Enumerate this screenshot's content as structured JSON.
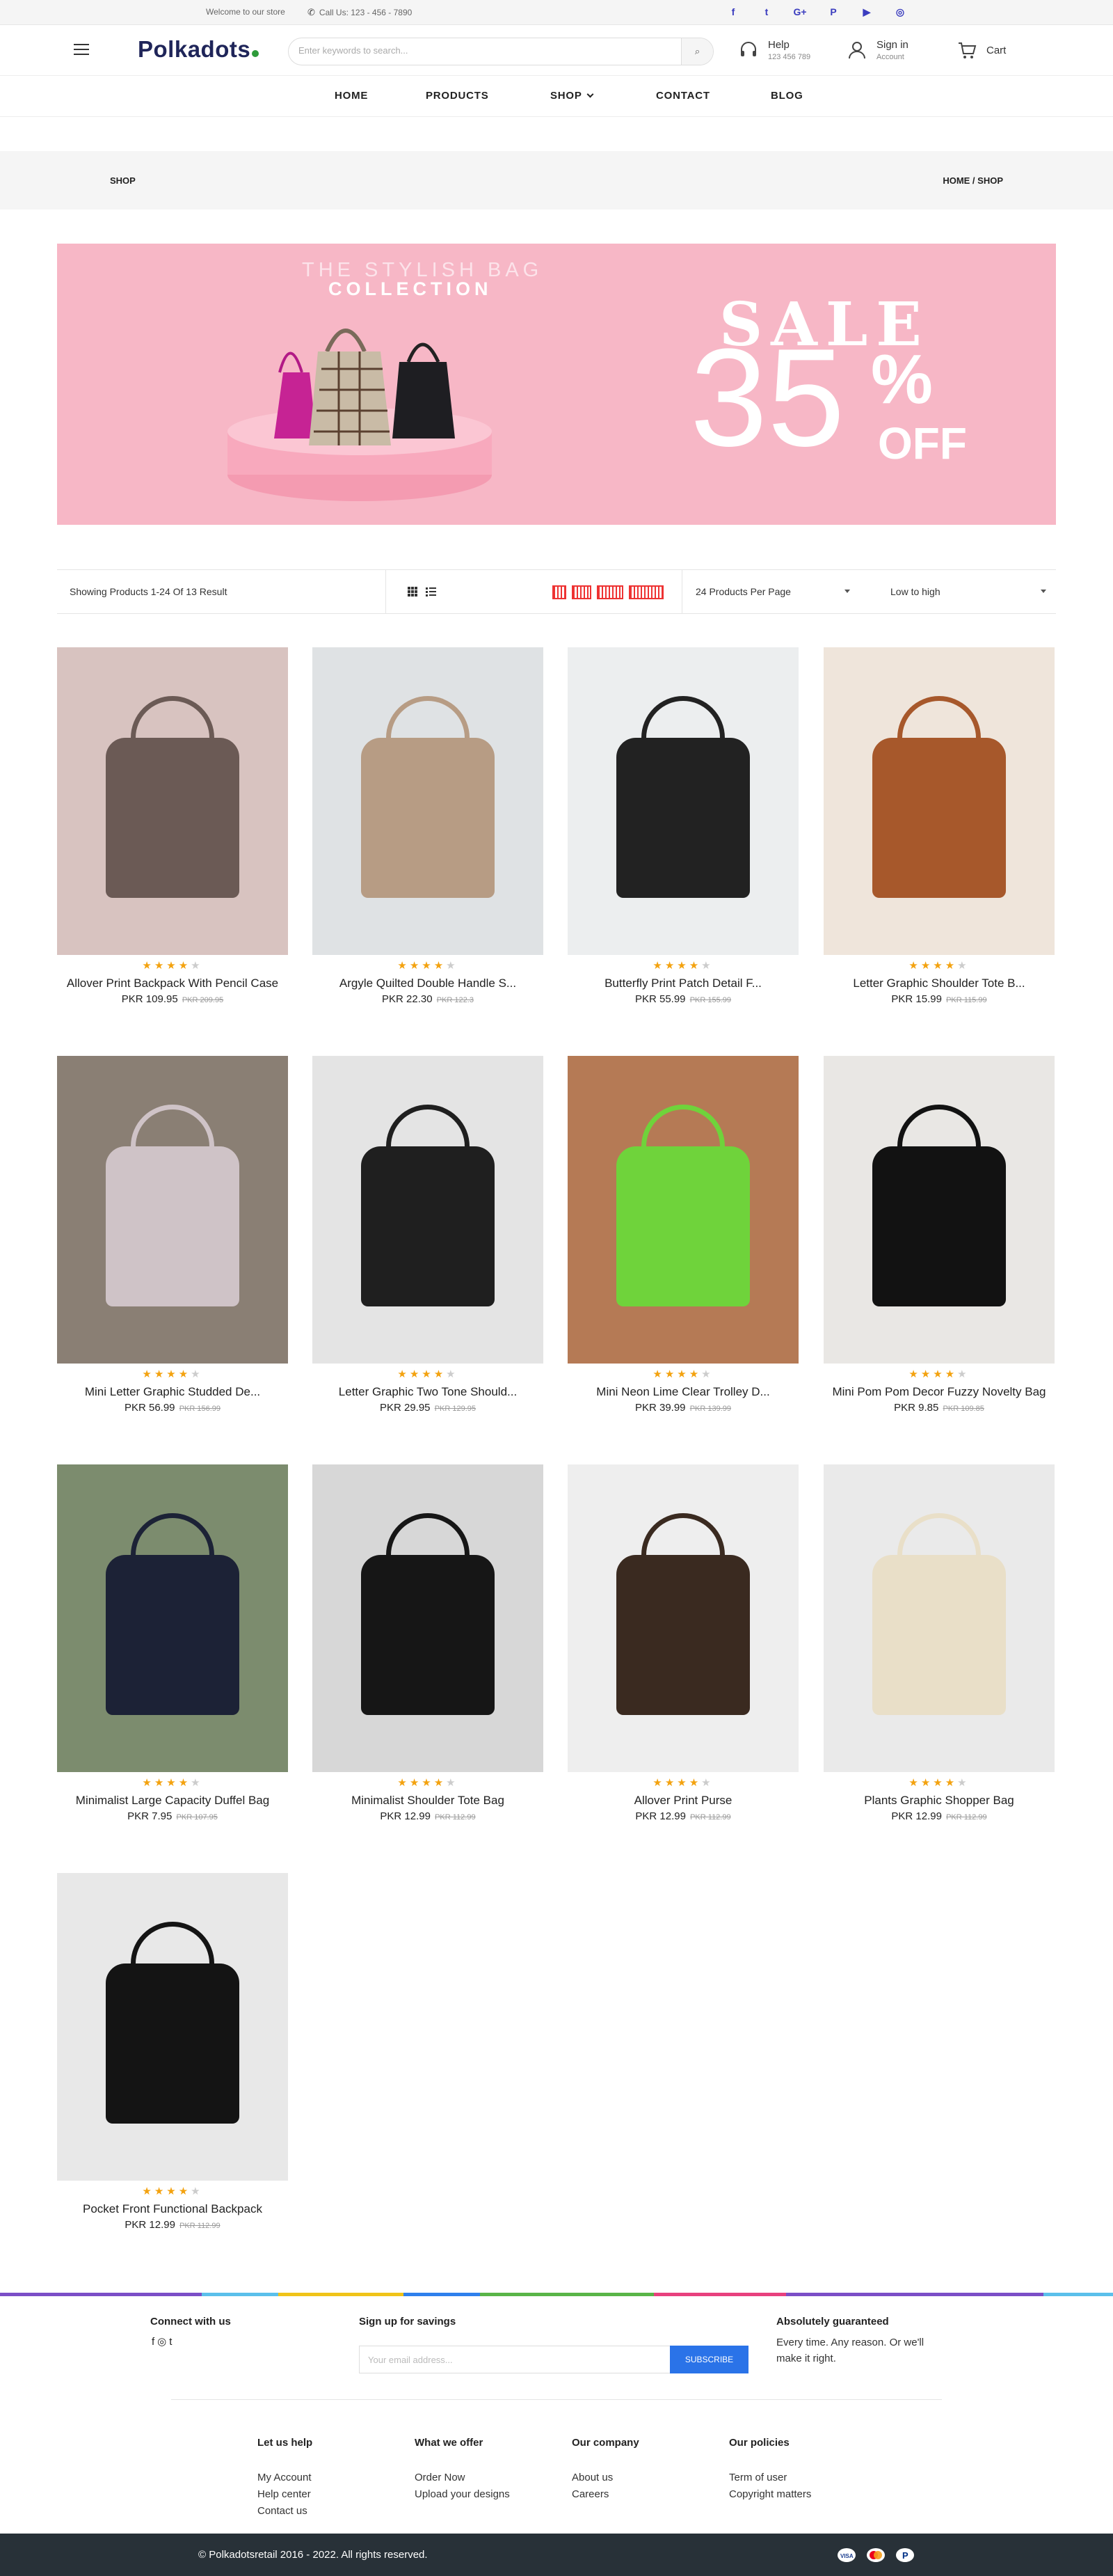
{
  "topbar": {
    "welcome": "Welcome to our store",
    "call": "Call Us: 123 - 456 - 7890",
    "social_icons": [
      "facebook-icon",
      "twitter-icon",
      "google-plus-icon",
      "pinterest-icon",
      "youtube-icon",
      "instagram-icon"
    ],
    "social_glyphs": [
      "f",
      "t",
      "G+",
      "P",
      "▶",
      "◎"
    ]
  },
  "header": {
    "logo": "Polkadots",
    "search_placeholder": "Enter keywords to search...",
    "help_label": "Help",
    "help_phone": "123 456 789",
    "signin_label": "Sign in",
    "signin_sub": "Account",
    "cart_label": "Cart"
  },
  "nav": {
    "items": [
      "HOME",
      "PRODUCTS",
      "SHOP",
      "CONTACT",
      "BLOG"
    ]
  },
  "breadcrumb": {
    "page_title": "SHOP",
    "trail": "HOME / SHOP"
  },
  "banner": {
    "line1": "THE STYLISH BAG",
    "line2": "COLLECTION",
    "sale": "SALE",
    "number": "35",
    "percent": "%",
    "off": "OFF"
  },
  "toolbar": {
    "showing": "Showing Products 1-24 Of 13 Result",
    "per_page": "24 Products Per Page",
    "sort": "Low to high"
  },
  "products": [
    {
      "name": "Allover Print Backpack With Pencil Case",
      "price": "PKR 109.95",
      "old": "PKR 209.95",
      "rating": 4
    },
    {
      "name": "Argyle Quilted Double Handle S...",
      "price": "PKR 22.30",
      "old": "PKR 122.3",
      "rating": 4
    },
    {
      "name": "Butterfly Print Patch Detail F...",
      "price": "PKR 55.99",
      "old": "PKR 155.99",
      "rating": 4
    },
    {
      "name": "Letter Graphic Shoulder Tote B...",
      "price": "PKR 15.99",
      "old": "PKR 115.99",
      "rating": 4
    },
    {
      "name": "Mini Letter Graphic Studded De...",
      "price": "PKR 56.99",
      "old": "PKR 156.99",
      "rating": 4
    },
    {
      "name": "Letter Graphic Two Tone Should...",
      "price": "PKR 29.95",
      "old": "PKR 129.95",
      "rating": 4
    },
    {
      "name": "Mini Neon Lime Clear Trolley D...",
      "price": "PKR 39.99",
      "old": "PKR 139.99",
      "rating": 4
    },
    {
      "name": "Mini Pom Pom Decor Fuzzy Novelty Bag",
      "price": "PKR 9.85",
      "old": "PKR 109.85",
      "rating": 4
    },
    {
      "name": "Minimalist Large Capacity Duffel Bag",
      "price": "PKR 7.95",
      "old": "PKR 107.95",
      "rating": 4
    },
    {
      "name": "Minimalist Shoulder Tote Bag",
      "price": "PKR 12.99",
      "old": "PKR 112.99",
      "rating": 4
    },
    {
      "name": "Allover Print Purse",
      "price": "PKR 12.99",
      "old": "PKR 112.99",
      "rating": 4
    },
    {
      "name": "Plants Graphic Shopper Bag",
      "price": "PKR 12.99",
      "old": "PKR 112.99",
      "rating": 4
    },
    {
      "name": "Pocket Front Functional Backpack",
      "price": "PKR 12.99",
      "old": "PKR 112.99",
      "rating": 4
    }
  ],
  "footer": {
    "connect_title": "Connect with us",
    "social_glyphs": "f◎t",
    "signup_title": "Sign up for savings",
    "email_placeholder": "Your email address...",
    "subscribe": "SUBSCRIBE",
    "guarantee_title": "Absolutely guaranteed",
    "guarantee_text_1": "Every time. Any reason. Or we'll",
    "guarantee_text_2": "make it right.",
    "columns": [
      {
        "title": "Let us help",
        "links": [
          "My Account",
          "Help center",
          "Contact us"
        ]
      },
      {
        "title": "What we offer",
        "links": [
          "Order Now",
          "Upload your designs"
        ]
      },
      {
        "title": "Our company",
        "links": [
          "About us",
          "Careers"
        ]
      },
      {
        "title": "Our policies",
        "links": [
          "Term of user",
          "Copyright matters"
        ]
      }
    ],
    "copyright": "© Polkadotsretail 2016 - 2022. All rights reserved.",
    "payment_icons": [
      "visa-icon",
      "mastercard-icon",
      "paypal-icon"
    ]
  },
  "colors": {
    "brand_navy": "#1f2559",
    "brand_green": "#2e9b3a",
    "star": "#f3a20f",
    "subscribe": "#2a73e8",
    "banner_pink": "#f7b7c6",
    "footer_dark": "#283138"
  }
}
